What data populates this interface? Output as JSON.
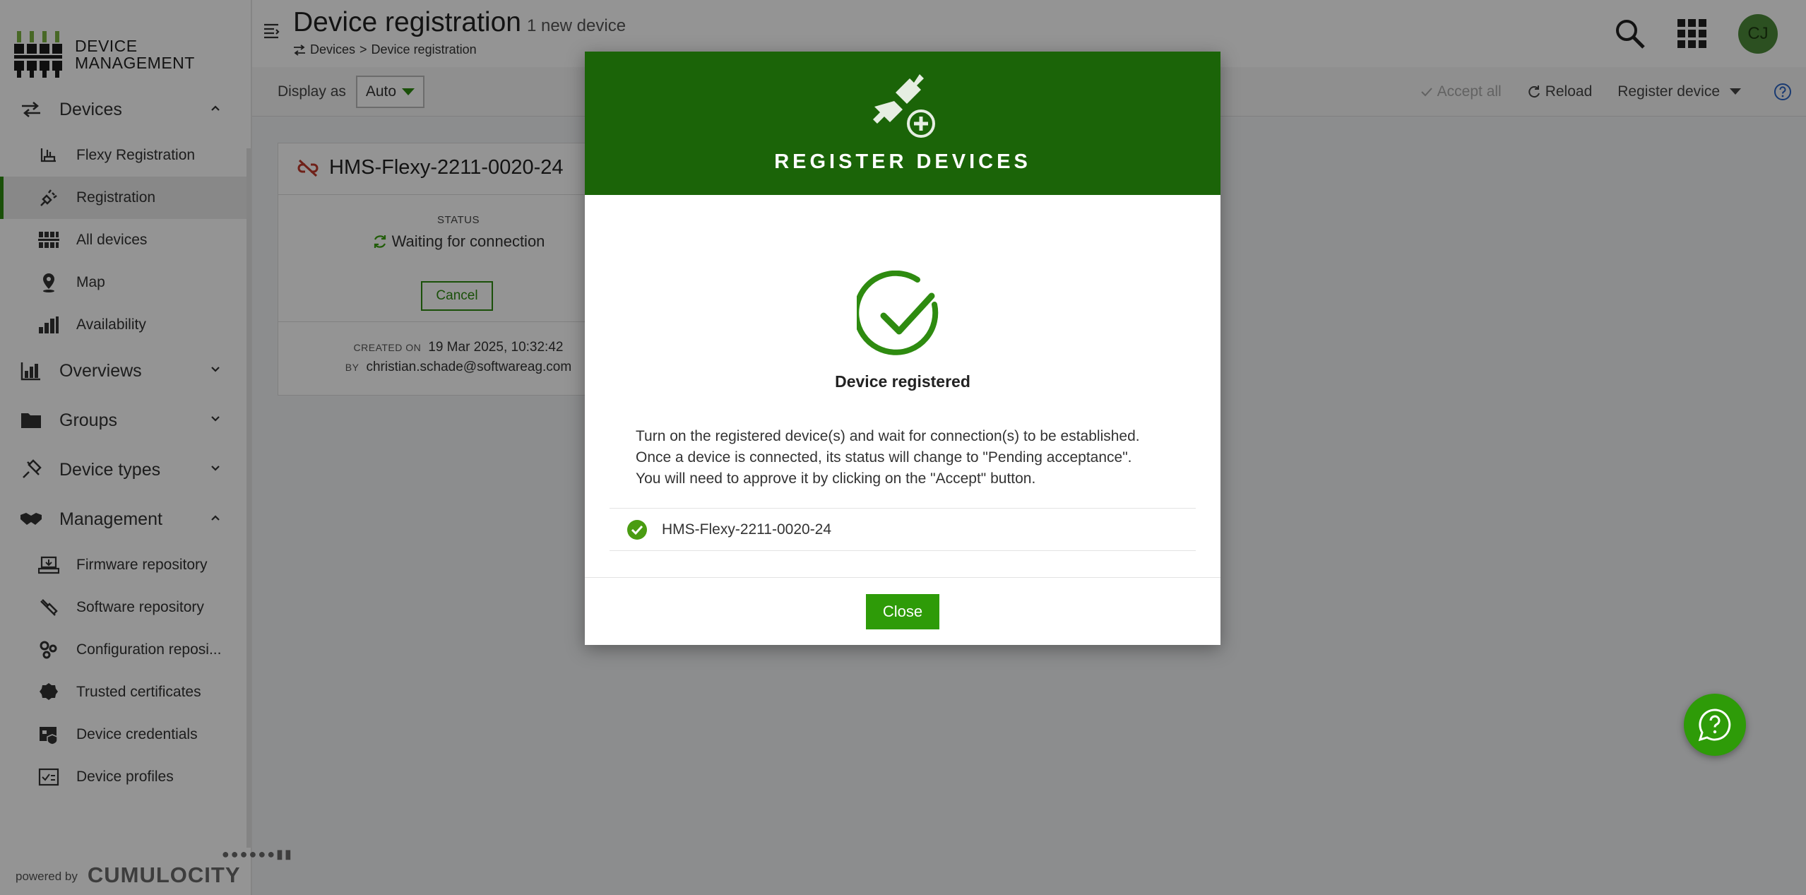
{
  "app": {
    "logo_line1": "DEVICE",
    "logo_line2": "MANAGEMENT",
    "powered_by": "powered by",
    "brand": "CUMULOCITY"
  },
  "sidebar": {
    "groups": [
      {
        "label": "Devices",
        "icon": "devices-arrows-icon",
        "expanded": true,
        "items": [
          {
            "label": "Flexy Registration",
            "icon": "router-icon"
          },
          {
            "label": "Registration",
            "icon": "plug-icon",
            "active": true
          },
          {
            "label": "All devices",
            "icon": "device-grid-icon"
          },
          {
            "label": "Map",
            "icon": "map-pin-icon"
          },
          {
            "label": "Availability",
            "icon": "bar-chart-icon"
          }
        ]
      },
      {
        "label": "Overviews",
        "icon": "dashboard-icon",
        "expanded": false
      },
      {
        "label": "Groups",
        "icon": "folder-icon",
        "expanded": false
      },
      {
        "label": "Device types",
        "icon": "device-types-icon",
        "expanded": false
      },
      {
        "label": "Management",
        "icon": "handshake-icon",
        "expanded": true,
        "items": [
          {
            "label": "Firmware repository",
            "icon": "firmware-icon"
          },
          {
            "label": "Software repository",
            "icon": "software-icon"
          },
          {
            "label": "Configuration reposi...",
            "icon": "config-gears-icon"
          },
          {
            "label": "Trusted certificates",
            "icon": "certificate-icon"
          },
          {
            "label": "Device credentials",
            "icon": "credentials-icon"
          },
          {
            "label": "Device profiles",
            "icon": "profile-icon"
          }
        ]
      }
    ]
  },
  "header": {
    "title": "Device registration",
    "subtitle": "1 new device",
    "breadcrumb_parent": "Devices",
    "breadcrumb_sep": ">",
    "breadcrumb_current": "Device registration",
    "avatar_initials": "CJ"
  },
  "actionbar": {
    "display_as_label": "Display as",
    "display_as_value": "Auto",
    "accept_all": "Accept all",
    "reload": "Reload",
    "register_device": "Register device"
  },
  "card": {
    "device_name": "HMS-Flexy-2211-0020-24",
    "status_label": "STATUS",
    "status_value": "Waiting for connection",
    "cancel_label": "Cancel",
    "created_on_label": "CREATED ON",
    "created_on_value": "19 Mar 2025, 10:32:42",
    "by_label": "BY",
    "by_value": "christian.schade@softwareag.com"
  },
  "modal": {
    "title": "REGISTER DEVICES",
    "success_title": "Device registered",
    "message_line1": "Turn on the registered device(s) and wait for connection(s) to be established.",
    "message_line2": "Once a device is connected, its status will change to \"Pending acceptance\".",
    "message_line3": "You will need to approve it by clicking on the \"Accept\" button.",
    "device": "HMS-Flexy-2211-0020-24",
    "close_label": "Close"
  },
  "colors": {
    "brand_green": "#2e9b08",
    "header_green": "#1b6408",
    "avatar": "#4d8a3a"
  }
}
